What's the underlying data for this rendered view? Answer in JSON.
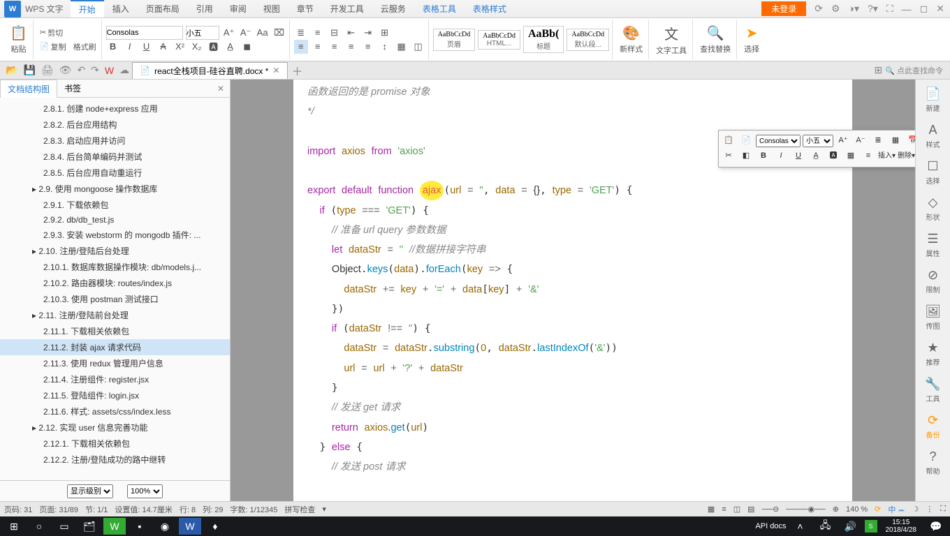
{
  "app": {
    "name": "WPS 文字",
    "login": "未登录"
  },
  "menu": {
    "tabs": [
      "开始",
      "插入",
      "页面布局",
      "引用",
      "审阅",
      "视图",
      "章节",
      "开发工具",
      "云服务",
      "表格工具",
      "表格样式"
    ],
    "active": 0
  },
  "ribbon": {
    "paste": "粘贴",
    "cut": "剪切",
    "copy": "复制",
    "fmtpaint": "格式刷",
    "font": "Consolas",
    "size": "小五",
    "styles": [
      {
        "preview": "AaBbCcDd",
        "name": "页眉"
      },
      {
        "preview": "AaBbCcDd",
        "name": "HTML..."
      },
      {
        "preview": "AaBb(",
        "name": "标题"
      },
      {
        "preview": "AaBbCcDd",
        "name": "默认段..."
      }
    ],
    "newstyle": "新样式",
    "texttool": "文字工具",
    "findreplace": "查找替换",
    "select": "选择"
  },
  "doc": {
    "name": "react全栈项目-硅谷直聘.docx *",
    "search_hint": "点此查找命令"
  },
  "sidebar": {
    "tab1": "文档结构图",
    "tab2": "书签",
    "items": [
      {
        "l": 2,
        "t": "2.8.1. 创建 node+express 应用"
      },
      {
        "l": 2,
        "t": "2.8.2. 后台应用结构"
      },
      {
        "l": 2,
        "t": "2.8.3. 启动应用并访问"
      },
      {
        "l": 2,
        "t": "2.8.4. 后台简单编码并测试"
      },
      {
        "l": 2,
        "t": "2.8.5. 后台应用自动重运行"
      },
      {
        "l": 1,
        "t": "▸ 2.9. 使用 mongoose 操作数据库"
      },
      {
        "l": 2,
        "t": "2.9.1. 下载依赖包"
      },
      {
        "l": 2,
        "t": "2.9.2. db/db_test.js"
      },
      {
        "l": 2,
        "t": "2.9.3. 安装 webstorm 的 mongodb 插件: ..."
      },
      {
        "l": 1,
        "t": "▸ 2.10. 注册/登陆后台处理"
      },
      {
        "l": 2,
        "t": "2.10.1. 数据库数据操作模块: db/models.j..."
      },
      {
        "l": 2,
        "t": "2.10.2. 路由器模块: routes/index.js"
      },
      {
        "l": 2,
        "t": "2.10.3. 使用 postman 测试接口"
      },
      {
        "l": 1,
        "t": "▸ 2.11. 注册/登陆前台处理"
      },
      {
        "l": 2,
        "t": "2.11.1. 下载相关依赖包"
      },
      {
        "l": 2,
        "t": "2.11.2. 封装 ajax 请求代码",
        "sel": true
      },
      {
        "l": 2,
        "t": "2.11.3. 使用 redux 管理用户信息"
      },
      {
        "l": 2,
        "t": "2.11.4. 注册组件: register.jsx"
      },
      {
        "l": 2,
        "t": "2.11.5. 登陆组件: login.jsx"
      },
      {
        "l": 2,
        "t": "2.11.6. 样式: assets/css/index.less"
      },
      {
        "l": 1,
        "t": "▸ 2.12. 实现 user 信息完善功能"
      },
      {
        "l": 2,
        "t": "2.12.1. 下载相关依赖包"
      },
      {
        "l": 2,
        "t": "2.12.2. 注册/登陆成功的路中继转"
      }
    ],
    "level_label": "显示级别",
    "zoom": "100%"
  },
  "code": {
    "l0": "函数返回的是 promise 对象",
    "l1": "*/",
    "import": "import",
    "axios": "axios",
    "from": "from",
    "axios_str": "'axios'",
    "export": "export",
    "default": "default",
    "function": "function",
    "ajax": "ajax",
    "url": "url",
    "eq": "=",
    "empty": "''",
    "data": "data",
    "obj": "{}",
    "type": "type",
    "get": "'GET'",
    "if": "if",
    "triple": "===",
    "c_url": "// 准备 url query 参数数据",
    "let": "let",
    "dataStr": "dataStr",
    "c_join": "//数据拼接字符串",
    "Object": "Object",
    "keys": "keys",
    "forEach": "forEach",
    "key": "key",
    "arrow": "=>",
    "plus_eq": "+=",
    "eq_str": "'='",
    "plus": "+",
    "amp": "'&'",
    "neq": "!==",
    "substring": "substring",
    "zero": "0",
    "lastIndexOf": "lastIndexOf",
    "q": "'?'",
    "c_get": "// 发送 get 请求",
    "return": "return",
    "dot": ".",
    "else": "else",
    "c_post": "// 发送 post 请求"
  },
  "mini": {
    "font": "Consolas",
    "size": "小五",
    "insert": "插入",
    "delete": "删除"
  },
  "rpanel": [
    "新建",
    "样式",
    "选择",
    "形状",
    "属性",
    "限制",
    "传图",
    "推荐",
    "工具",
    "备份",
    "帮助"
  ],
  "status": {
    "page_no": "页码: 31",
    "pages": "页面: 31/89",
    "sec": "节: 1/1",
    "pos": "设置值: 14.7厘米",
    "row": "行: 8",
    "col": "列: 29",
    "chars": "字数: 1/12345",
    "spell": "拼写检查",
    "zoom": "140 %"
  },
  "taskbar": {
    "api": "API docs",
    "time": "15:15",
    "date": "2018/4/28"
  }
}
